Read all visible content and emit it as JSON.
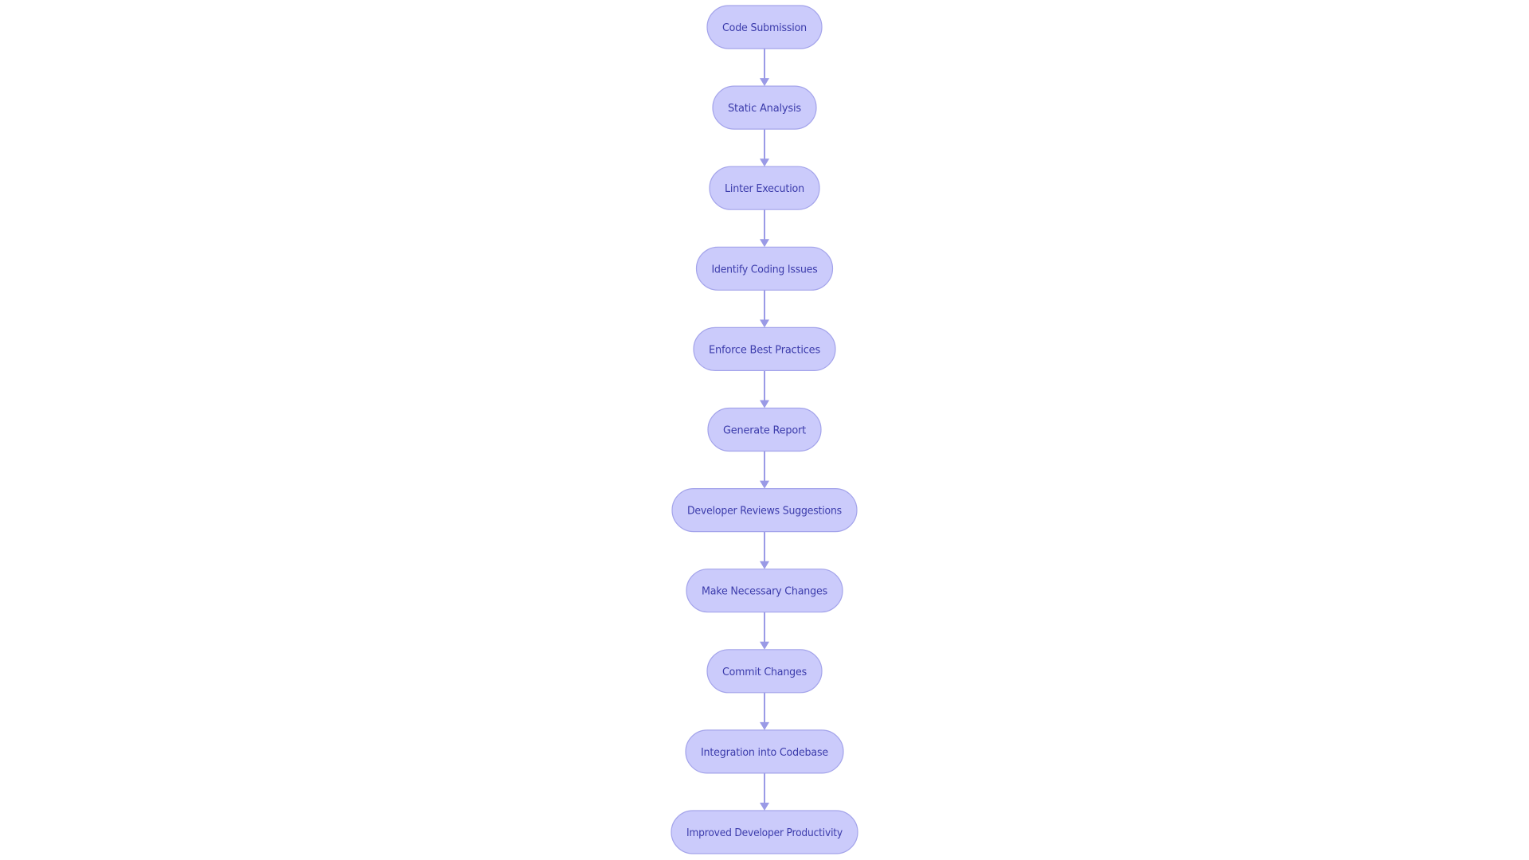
{
  "diagram": {
    "type": "flowchart",
    "direction": "top-to-bottom",
    "node_shape": "stadium",
    "colors": {
      "node_fill": "#cbcbfb",
      "node_stroke": "#a3a3ea",
      "node_text": "#3b3bab",
      "edge": "#9a9ae6",
      "background": "#ffffff"
    },
    "nodes": [
      {
        "id": "code-submission",
        "label": "Code Submission"
      },
      {
        "id": "static-analysis",
        "label": "Static Analysis"
      },
      {
        "id": "linter-execution",
        "label": "Linter Execution"
      },
      {
        "id": "identify-coding-issues",
        "label": "Identify Coding Issues"
      },
      {
        "id": "enforce-best-practices",
        "label": "Enforce Best Practices"
      },
      {
        "id": "generate-report",
        "label": "Generate Report"
      },
      {
        "id": "developer-reviews-suggestions",
        "label": "Developer Reviews Suggestions"
      },
      {
        "id": "make-necessary-changes",
        "label": "Make Necessary Changes"
      },
      {
        "id": "commit-changes",
        "label": "Commit Changes"
      },
      {
        "id": "integration-into-codebase",
        "label": "Integration into Codebase"
      },
      {
        "id": "improved-developer-productivity",
        "label": "Improved Developer Productivity"
      }
    ],
    "edges": [
      {
        "from": "code-submission",
        "to": "static-analysis"
      },
      {
        "from": "static-analysis",
        "to": "linter-execution"
      },
      {
        "from": "linter-execution",
        "to": "identify-coding-issues"
      },
      {
        "from": "identify-coding-issues",
        "to": "enforce-best-practices"
      },
      {
        "from": "enforce-best-practices",
        "to": "generate-report"
      },
      {
        "from": "generate-report",
        "to": "developer-reviews-suggestions"
      },
      {
        "from": "developer-reviews-suggestions",
        "to": "make-necessary-changes"
      },
      {
        "from": "make-necessary-changes",
        "to": "commit-changes"
      },
      {
        "from": "commit-changes",
        "to": "integration-into-codebase"
      },
      {
        "from": "integration-into-codebase",
        "to": "improved-developer-productivity"
      }
    ]
  }
}
